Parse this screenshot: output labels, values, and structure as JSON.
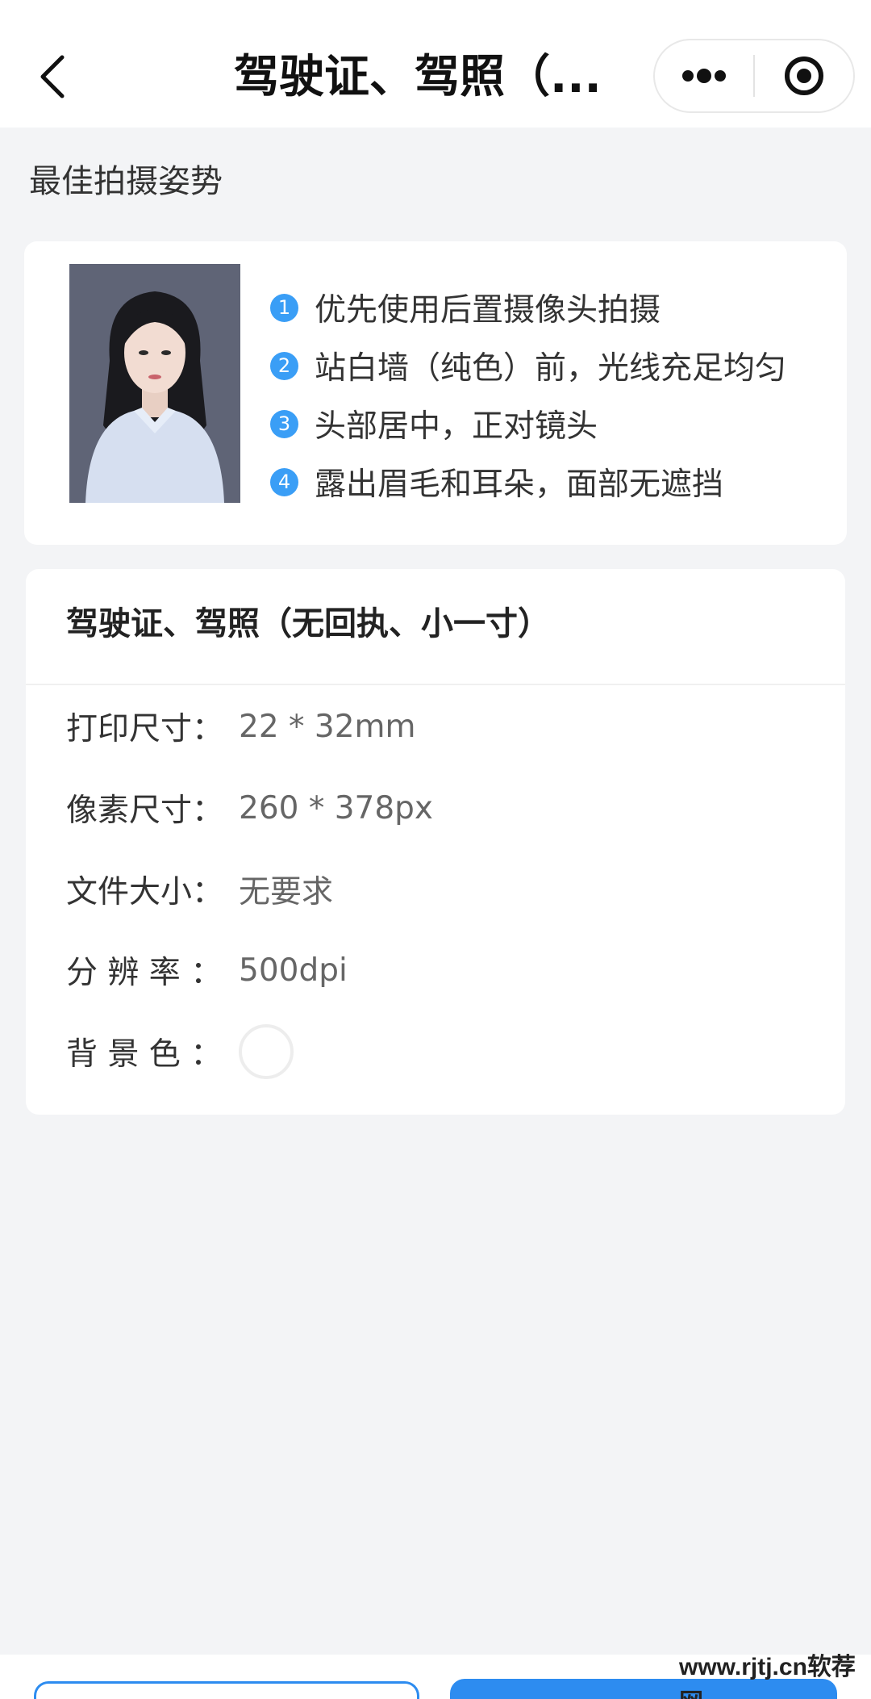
{
  "header": {
    "title": "驾驶证、驾照（...",
    "back_icon": "chevron-left-icon",
    "more_icon": "more-dots-icon",
    "close_icon": "target-circle-icon"
  },
  "tips": {
    "section_title": "最佳拍摄姿势",
    "items": [
      {
        "num": "1",
        "text": "优先使用后置摄像头拍摄"
      },
      {
        "num": "2",
        "text": "站白墙（纯色）前，光线充足均匀"
      },
      {
        "num": "3",
        "text": "头部居中，正对镜头"
      },
      {
        "num": "4",
        "text": "露出眉毛和耳朵，面部无遮挡"
      }
    ],
    "accent_color": "#3a9ef6"
  },
  "spec": {
    "title": "驾驶证、驾照（无回执、小一寸）",
    "rows": [
      {
        "label": "打印尺寸：",
        "value": "22 * 32mm"
      },
      {
        "label": "像素尺寸：",
        "value": "260 * 378px"
      },
      {
        "label": "文件大小：",
        "value": "无要求"
      },
      {
        "label": "分 辨 率 ：",
        "value": "500dpi"
      },
      {
        "label": "背 景 色 ：",
        "value": ""
      }
    ],
    "background_color": "#ffffff"
  },
  "watermark": "www.rjtj.cn软荐网",
  "colors": {
    "primary": "#2d8cf0",
    "page_bg": "#f3f4f6"
  }
}
